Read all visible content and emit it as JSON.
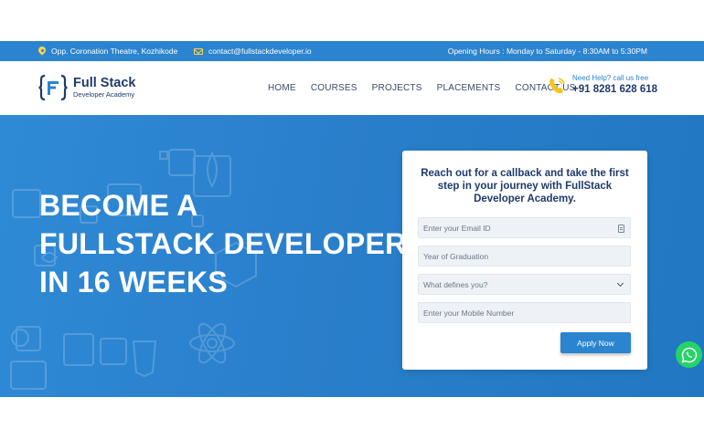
{
  "topbar": {
    "location": "Opp. Coronation Theatre, Kozhikode",
    "email": "contact@fullstackdeveloper.io",
    "hours": "Opening Hours : Monday to Saturday - 8:30AM to 5:30PM",
    "icon_color": "#ffd54a",
    "bg_color": "#2b84cf"
  },
  "logo": {
    "line1": "Full Stack",
    "line2": "Developer Academy"
  },
  "nav": {
    "items": [
      "HOME",
      "COURSES",
      "PROJECTS",
      "PLACEMENTS",
      "CONTACT US"
    ]
  },
  "help": {
    "label": "Need Help? call us free",
    "phone": "+91 8281 628 618"
  },
  "hero": {
    "headline_1": "BECOME A",
    "headline_2": "FULLSTACK DEVELOPER",
    "headline_3": "IN 16 WEEKS"
  },
  "form": {
    "title": "Reach out for a callback and take the first step in your journey with FullStack Developer Academy.",
    "email_placeholder": "Enter your Email ID",
    "grad_placeholder": "Year of Graduation",
    "defines_selected": "What defines you?",
    "mobile_placeholder": "Enter your Mobile Number",
    "submit_label": "Apply Now"
  },
  "icons": {
    "location": "location-pin-icon",
    "email": "mail-icon",
    "phone": "phone-icon",
    "whatsapp": "whatsapp-icon"
  }
}
